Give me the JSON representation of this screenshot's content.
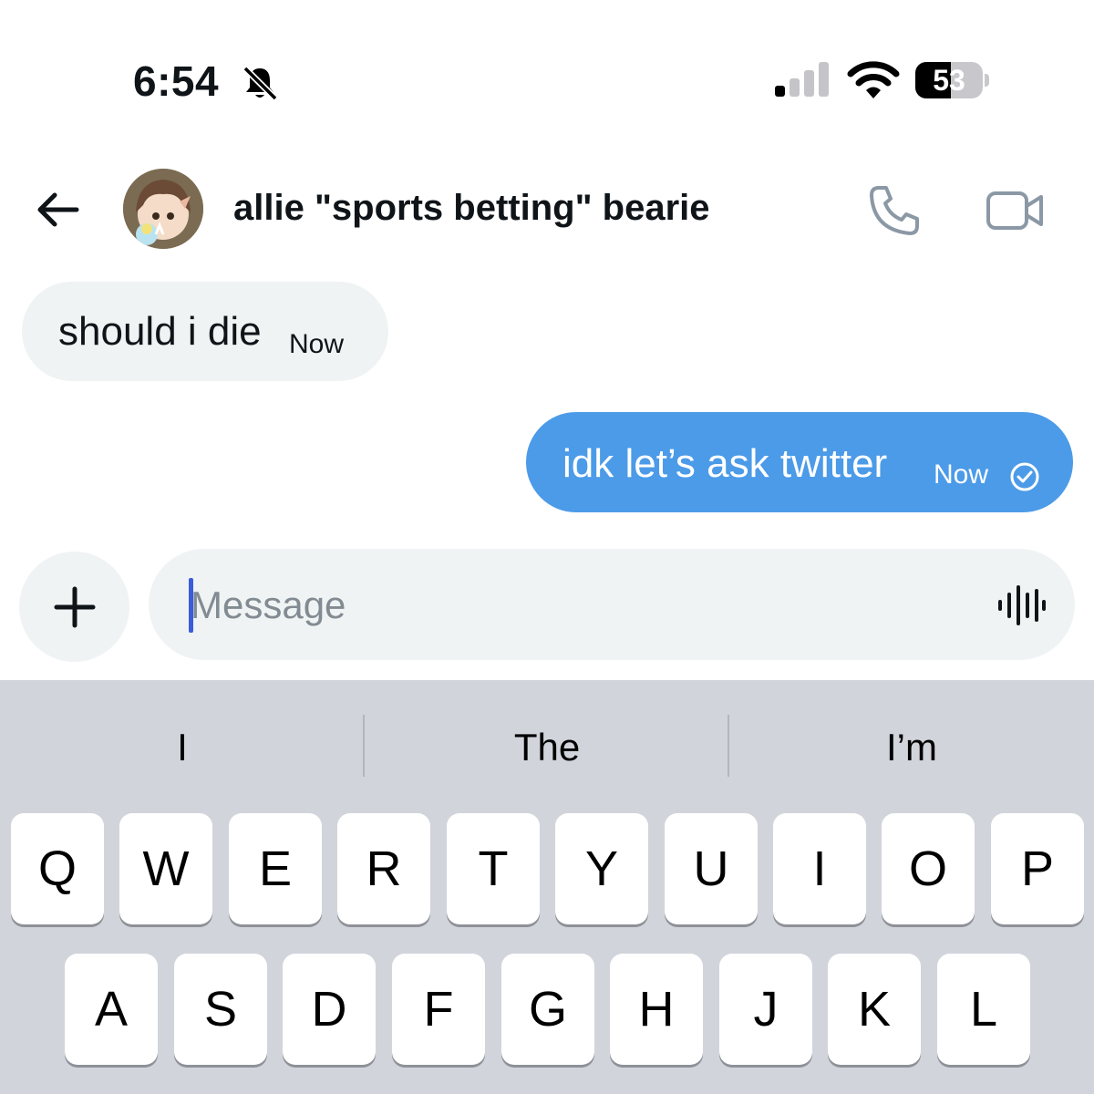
{
  "status_bar": {
    "time": "6:54",
    "battery_level": "53",
    "battery_fraction": 0.53
  },
  "header": {
    "title": "allie \"sports betting\" bearie"
  },
  "messages": [
    {
      "direction": "incoming",
      "text": "should i die",
      "time": "Now"
    },
    {
      "direction": "outgoing",
      "text": "idk let’s ask twitter",
      "time": "Now",
      "status": "sent"
    }
  ],
  "composer": {
    "placeholder": "Message",
    "value": ""
  },
  "keyboard": {
    "suggestions": [
      "I",
      "The",
      "I’m"
    ],
    "row1": [
      "Q",
      "W",
      "E",
      "R",
      "T",
      "Y",
      "U",
      "I",
      "O",
      "P"
    ],
    "row2": [
      "A",
      "S",
      "D",
      "F",
      "G",
      "H",
      "J",
      "K",
      "L"
    ]
  },
  "colors": {
    "outgoing_bubble": "#4c9be8",
    "incoming_bubble": "#eff3f4",
    "keyboard_bg": "#d1d4db"
  }
}
